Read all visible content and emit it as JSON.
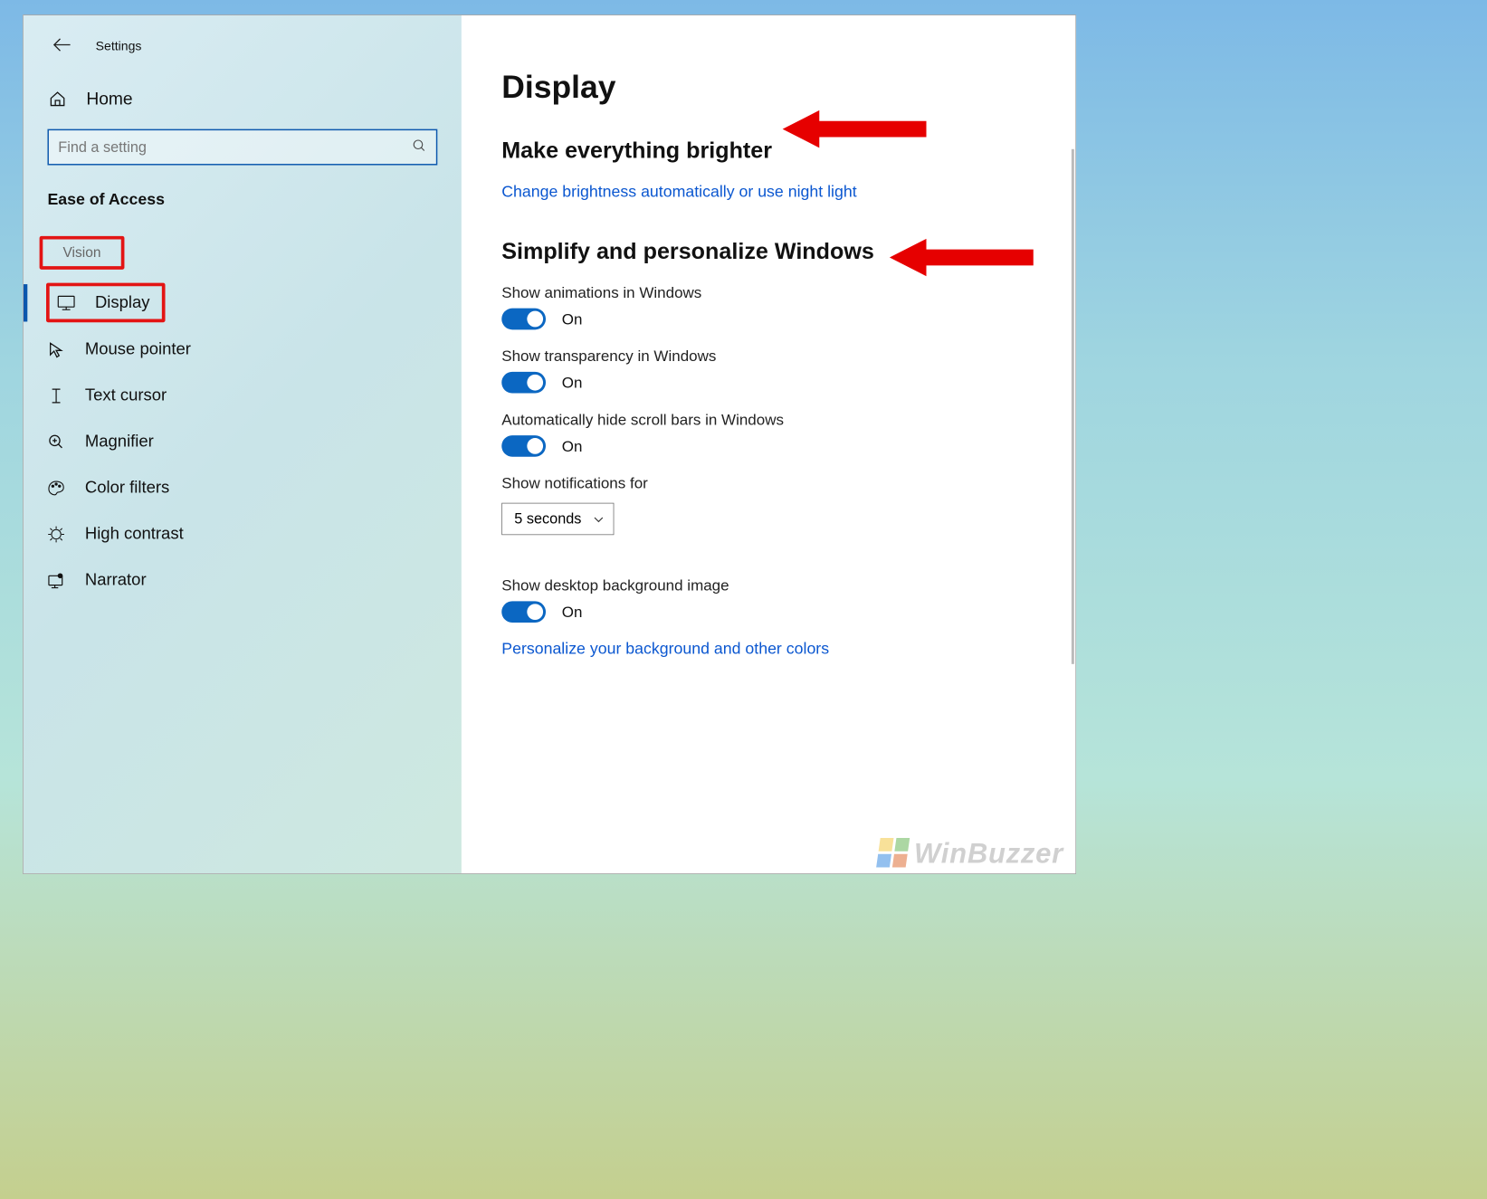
{
  "window": {
    "title": "Settings"
  },
  "sidebar": {
    "home": "Home",
    "search_placeholder": "Find a setting",
    "group": "Ease of Access",
    "category": "Vision",
    "items": [
      {
        "label": "Display",
        "icon": "monitor"
      },
      {
        "label": "Mouse pointer",
        "icon": "mouse"
      },
      {
        "label": "Text cursor",
        "icon": "textcursor"
      },
      {
        "label": "Magnifier",
        "icon": "magnifier"
      },
      {
        "label": "Color filters",
        "icon": "palette"
      },
      {
        "label": "High contrast",
        "icon": "contrast"
      },
      {
        "label": "Narrator",
        "icon": "narrator"
      }
    ]
  },
  "main": {
    "title": "Display",
    "section1": "Make everything brighter",
    "link1": "Change brightness automatically or use night light",
    "section2": "Simplify and personalize Windows",
    "opt_anim": "Show animations in Windows",
    "opt_trans": "Show transparency in Windows",
    "opt_scroll": "Automatically hide scroll bars in Windows",
    "opt_notif": "Show notifications for",
    "notif_value": "5 seconds",
    "opt_bg": "Show desktop background image",
    "link2": "Personalize your background and other colors",
    "on": "On"
  },
  "watermark": "WinBuzzer"
}
